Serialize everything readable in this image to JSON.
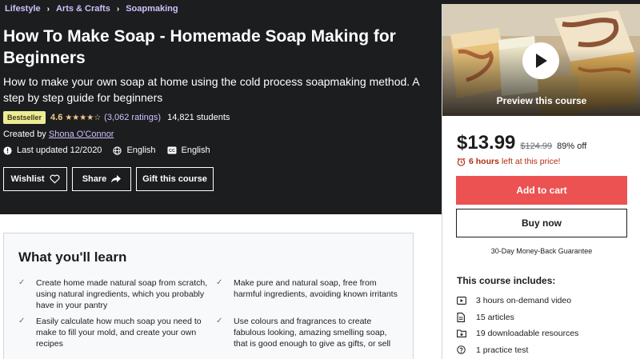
{
  "breadcrumb": [
    "Lifestyle",
    "Arts & Crafts",
    "Soapmaking"
  ],
  "course": {
    "title": "How To Make Soap - Homemade Soap Making for Beginners",
    "subtitle": "How to make your own soap at home using the cold process soapmaking method. A step by step guide for beginners",
    "badge": "Bestseller",
    "rating": "4.6",
    "ratings_count": "(3,062 ratings)",
    "students": "14,821 students",
    "created_by_label": "Created by",
    "author": "Shona O'Connor",
    "last_updated": "Last updated 12/2020",
    "language": "English",
    "captions": "English",
    "colors": {
      "background": "#1c1d1f",
      "link": "#cec0fc",
      "star": "#f3ca8c"
    }
  },
  "actions": {
    "wishlist": "Wishlist",
    "share": "Share",
    "gift": "Gift this course"
  },
  "learn": {
    "title": "What you'll learn",
    "items": [
      "Create home made natural soap from scratch, using natural ingredients, which you probably have in your pantry",
      "Make pure and natural soap, free from harmful ingredients, avoiding known irritants",
      "Easily calculate how much soap you need to make to fill your mold, and create your own recipes",
      "Use colours and fragrances to create fabulous looking, amazing smelling soap, that is good enough to give as gifts, or sell"
    ]
  },
  "sidebar": {
    "preview_label": "Preview this course",
    "price": "$13.99",
    "original_price": "$124.99",
    "discount": "89% off",
    "timer_hours": "6 hours",
    "timer_text": "left at this price!",
    "add_to_cart": "Add to cart",
    "buy_now": "Buy now",
    "guarantee": "30-Day Money-Back Guarantee",
    "includes_title": "This course includes:",
    "includes": [
      {
        "icon": "video-icon",
        "text": "3 hours on-demand video"
      },
      {
        "icon": "file-icon",
        "text": "15 articles"
      },
      {
        "icon": "folder-download-icon",
        "text": "19 downloadable resources"
      },
      {
        "icon": "help-circle-icon",
        "text": "1 practice test"
      }
    ],
    "colors": {
      "cart_button": "#ec5252",
      "timer": "#b32d0f"
    }
  }
}
